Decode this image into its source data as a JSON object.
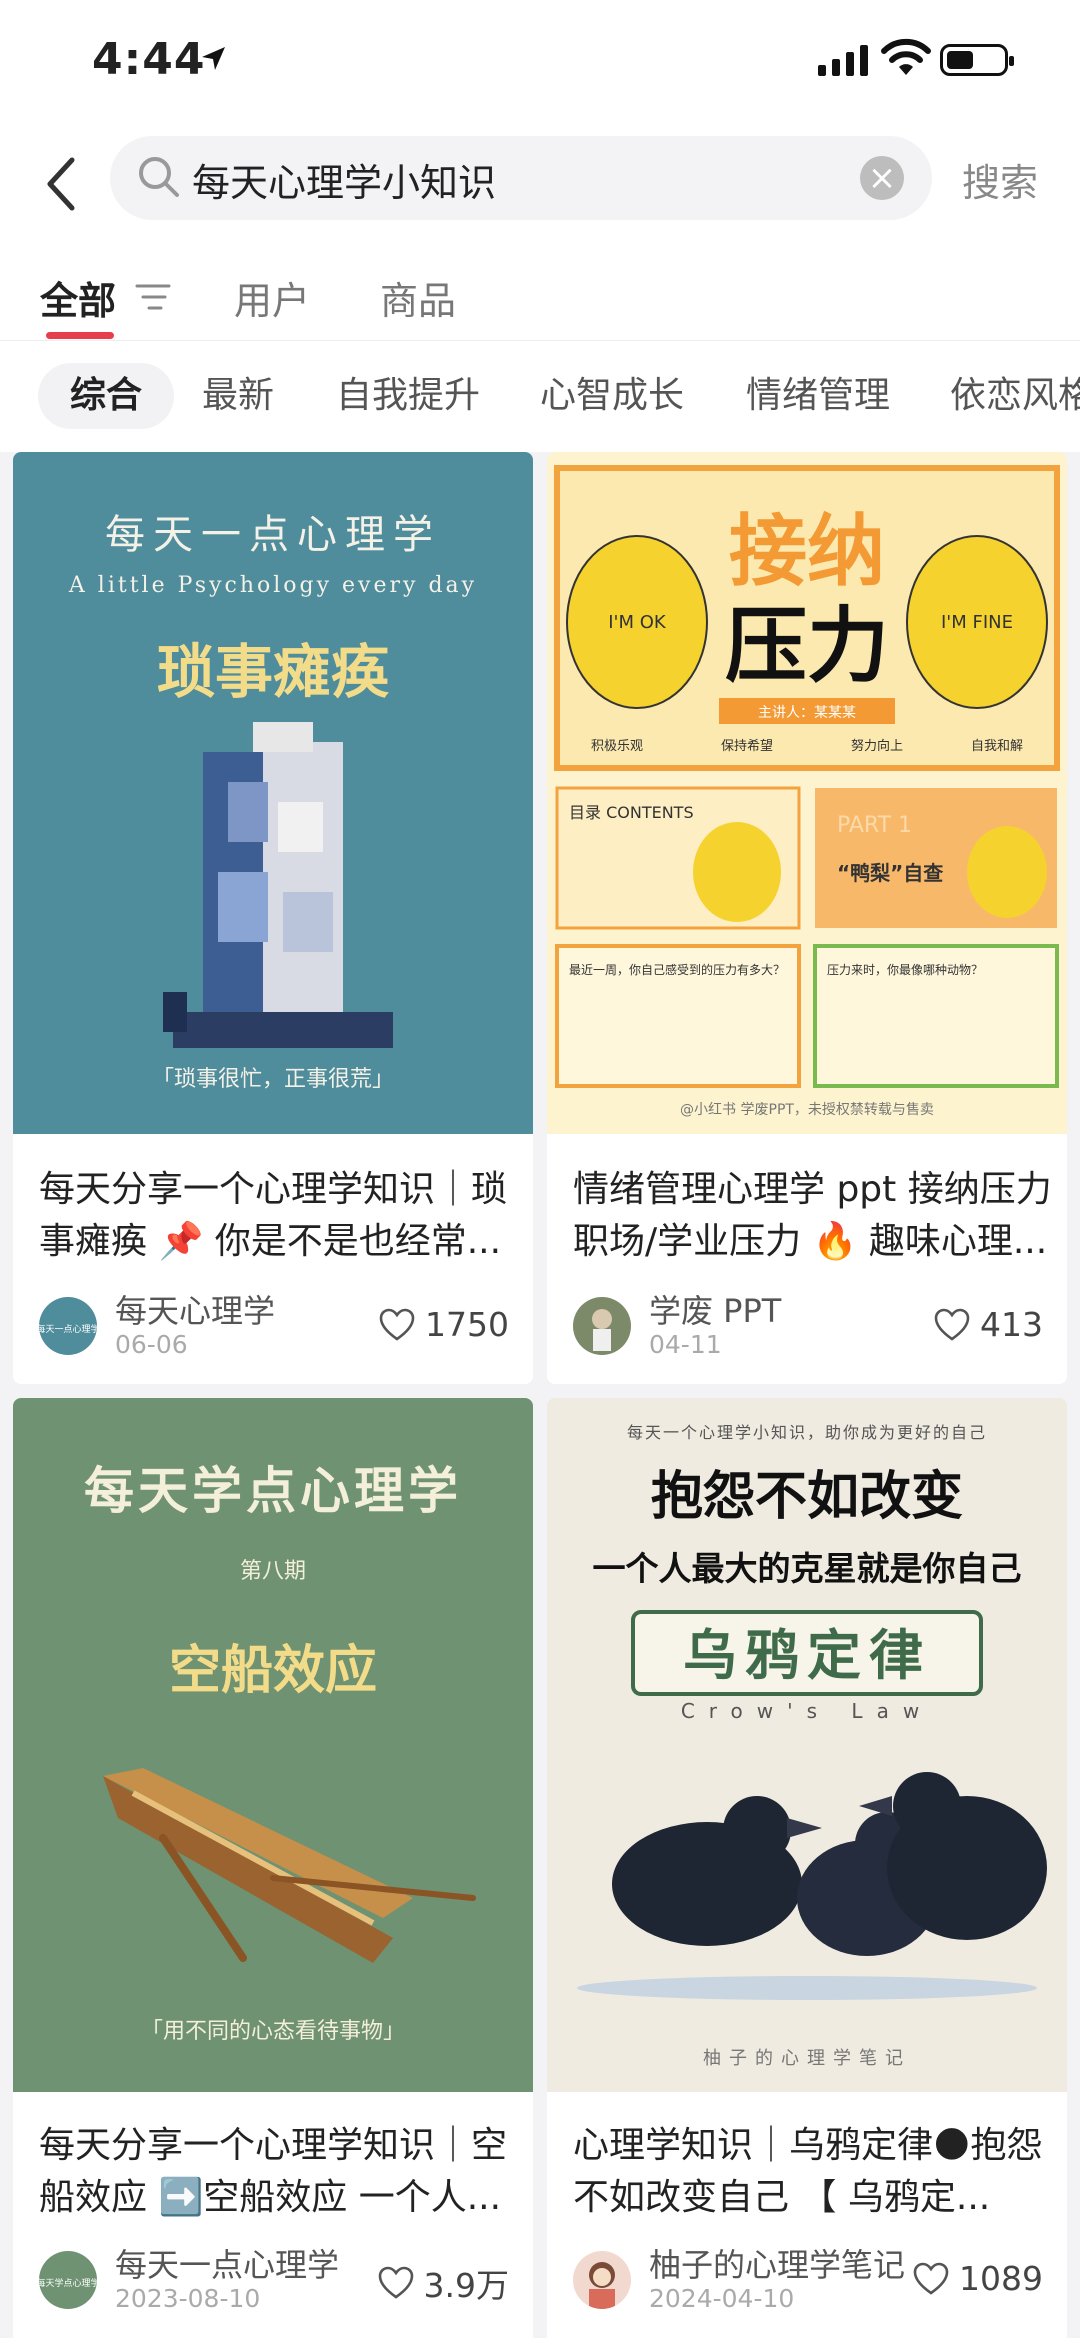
{
  "status": {
    "time": "4:44"
  },
  "search": {
    "query": "每天心理学小知识",
    "submit_label": "搜索"
  },
  "tabs": [
    {
      "label": "全部"
    },
    {
      "label": "用户"
    },
    {
      "label": "商品"
    }
  ],
  "chips": [
    {
      "label": "综合"
    },
    {
      "label": "最新"
    },
    {
      "label": "自我提升"
    },
    {
      "label": "心智成长"
    },
    {
      "label": "情绪管理"
    },
    {
      "label": "依恋风格"
    }
  ],
  "notes": [
    {
      "cover": {
        "heading": "每天一点心理学",
        "sub": "A little Psychology every day",
        "topic": "琐事瘫痪",
        "caption": "「琐事很忙，正事很荒」"
      },
      "title": "每天分享一个心理学知识｜琐事瘫痪 📌 你是不是也经常...",
      "author": "每天心理学",
      "avatar_text": "每天一点心理学",
      "date": "06-06",
      "likes": "1750"
    },
    {
      "cover": {
        "title1": "接纳",
        "title2": "压力",
        "left": "I'M OK",
        "right": "I'M FINE",
        "speaker": "主讲人：某某某",
        "points": [
          "积极乐观",
          "保持希望",
          "努力向上",
          "自我和解"
        ],
        "contents": "目录 CONTENTS",
        "part": "PART 1",
        "part_title": "“鸭梨”自查",
        "q1": "最近一周，你自己感受到的压力有多大？",
        "q2": "压力来时，你最像哪种动物？",
        "watermark": "@小红书 学废PPT，未授权禁转载与售卖"
      },
      "title": "情绪管理心理学 ppt 接纳压力 职场/学业压力 🔥 趣味心理...",
      "author": "学废 PPT",
      "date": "04-11",
      "likes": "413"
    },
    {
      "cover": {
        "heading": "每天学点心理学",
        "issue": "第八期",
        "topic": "空船效应",
        "caption": "「用不同的心态看待事物」"
      },
      "title": "每天分享一个心理学知识｜空船效应 ➡️空船效应 一个人...",
      "author": "每天一点心理学",
      "avatar_text": "每天学点心理学",
      "date": "2023-08-10",
      "likes": "3.9万"
    },
    {
      "cover": {
        "tagline": "每天一个心理学小知识，助你成为更好的自己",
        "line1": "抱怨不如改变",
        "line2": "一个人最大的克星就是你自己",
        "topic": "乌鸦定律",
        "latin": "Crow's Law",
        "footer": "柚子的心理学笔记"
      },
      "title": "心理学知识｜乌鸦定律🌑抱怨不如改变自己 【 乌鸦定...",
      "author": "柚子的心理学笔记",
      "date": "2024-04-10",
      "likes": "1089"
    }
  ],
  "colors": {
    "accent": "#e73d4c",
    "cover1_bg": "#4f8c9c",
    "cover2_bg": "#fdf4cf",
    "cover3_bg": "#6e9272",
    "cover4_bg": "#efebe0",
    "title_gold": "#f3dc89"
  }
}
